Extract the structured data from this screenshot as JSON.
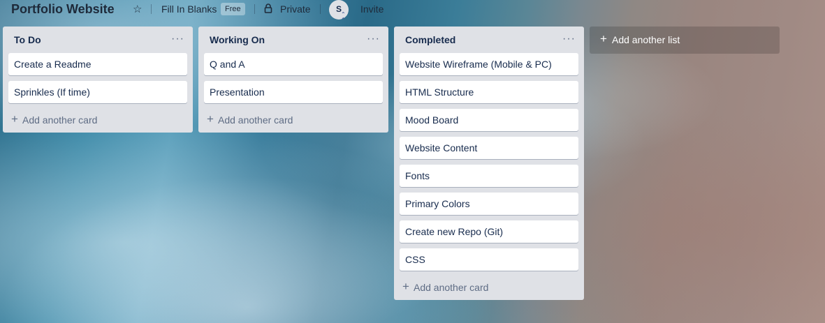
{
  "header": {
    "board_title": "Portfolio Website",
    "star_icon": "star-icon",
    "team_name": "Fill In Blanks",
    "team_badge": "Free",
    "visibility_icon": "lock-icon",
    "visibility": "Private",
    "member_initial": "S",
    "invite_label": "Invite"
  },
  "lists": [
    {
      "title": "To Do",
      "menu": "···",
      "cards": [
        "Create a Readme",
        "Sprinkles (If time)"
      ],
      "add_card_label": "Add another card"
    },
    {
      "title": "Working On",
      "menu": "···",
      "cards": [
        "Q and A",
        "Presentation"
      ],
      "add_card_label": "Add another card"
    },
    {
      "title": "Completed",
      "menu": "···",
      "cards": [
        "Website Wireframe (Mobile & PC)",
        "HTML Structure",
        "Mood Board",
        "Website Content",
        "Fonts",
        "Primary Colors",
        "Create new Repo (Git)",
        "CSS"
      ],
      "add_card_label": "Add another card"
    }
  ],
  "add_list_label": "Add another list",
  "colors": {
    "list_bg": "#dfe1e6",
    "card_bg": "#ffffff",
    "text": "#172b4d",
    "muted": "#5e6c84"
  }
}
